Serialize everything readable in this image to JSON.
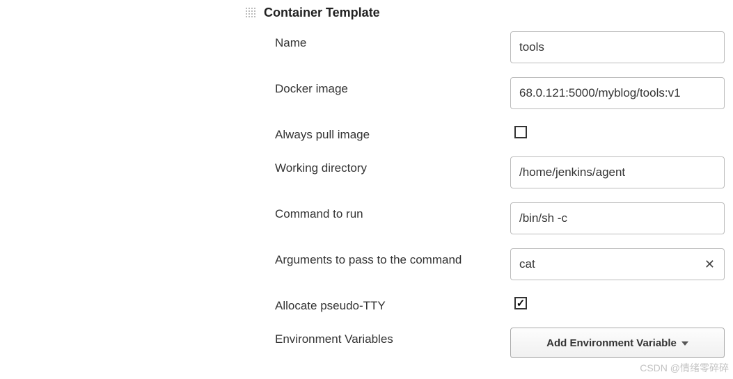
{
  "section": {
    "title": "Container Template"
  },
  "fields": {
    "name": {
      "label": "Name",
      "value": "tools"
    },
    "docker_image": {
      "label": "Docker image",
      "value": "68.0.121:5000/myblog/tools:v1"
    },
    "always_pull": {
      "label": "Always pull image",
      "checked": false
    },
    "working_dir": {
      "label": "Working directory",
      "value": "/home/jenkins/agent"
    },
    "command": {
      "label": "Command to run",
      "value": "/bin/sh -c"
    },
    "arguments": {
      "label": "Arguments to pass to the command",
      "value": "cat"
    },
    "tty": {
      "label": "Allocate pseudo-TTY",
      "checked": true
    },
    "env_vars": {
      "label": "Environment Variables",
      "button": "Add Environment Variable"
    }
  },
  "watermark": "CSDN @情绪零碎碎"
}
